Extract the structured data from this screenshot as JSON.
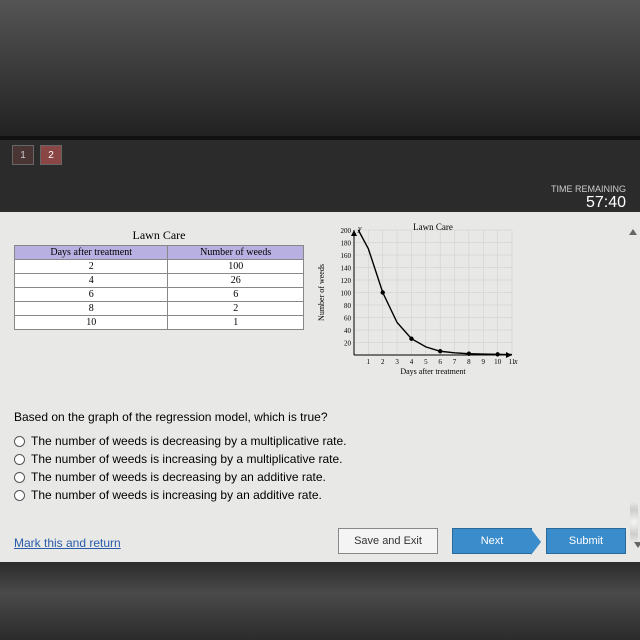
{
  "timer": {
    "label": "TIME REMAINING",
    "value": "57:40"
  },
  "nav": {
    "btn1": "1",
    "btn2": "2"
  },
  "table": {
    "title": "Lawn Care",
    "headers": [
      "Days after treatment",
      "Number of weeds"
    ],
    "rows": [
      [
        "2",
        "100"
      ],
      [
        "4",
        "26"
      ],
      [
        "6",
        "6"
      ],
      [
        "8",
        "2"
      ],
      [
        "10",
        "1"
      ]
    ]
  },
  "chart_data": {
    "type": "scatter",
    "title": "Lawn Care",
    "xlabel": "Days after treatment",
    "ylabel": "Number of weeds",
    "xticks": [
      1,
      2,
      3,
      4,
      5,
      6,
      7,
      8,
      9,
      10,
      11
    ],
    "yticks": [
      20,
      40,
      60,
      80,
      100,
      120,
      140,
      160,
      180,
      200
    ],
    "xlim": [
      0,
      11
    ],
    "ylim": [
      0,
      200
    ],
    "points": [
      {
        "x": 2,
        "y": 100
      },
      {
        "x": 4,
        "y": 26
      },
      {
        "x": 6,
        "y": 6
      },
      {
        "x": 8,
        "y": 2
      },
      {
        "x": 10,
        "y": 1
      }
    ],
    "curve": [
      {
        "x": 0.3,
        "y": 200
      },
      {
        "x": 1,
        "y": 170
      },
      {
        "x": 2,
        "y": 100
      },
      {
        "x": 3,
        "y": 52
      },
      {
        "x": 4,
        "y": 26
      },
      {
        "x": 5,
        "y": 13
      },
      {
        "x": 6,
        "y": 6
      },
      {
        "x": 7,
        "y": 3.5
      },
      {
        "x": 8,
        "y": 2
      },
      {
        "x": 9,
        "y": 1.4
      },
      {
        "x": 10,
        "y": 1
      },
      {
        "x": 11,
        "y": 0.7
      }
    ],
    "axis_y_label_letter": "y",
    "axis_x_label_letter": "x"
  },
  "question": "Based on the graph of the regression model, which is true?",
  "options": [
    "The number of weeds is decreasing by a multiplicative rate.",
    "The number of weeds is increasing by a multiplicative rate.",
    "The number of weeds is decreasing by an additive rate.",
    "The number of weeds is increasing by an additive rate."
  ],
  "footer": {
    "mark": "Mark this and return",
    "save": "Save and Exit",
    "next": "Next",
    "submit": "Submit"
  }
}
